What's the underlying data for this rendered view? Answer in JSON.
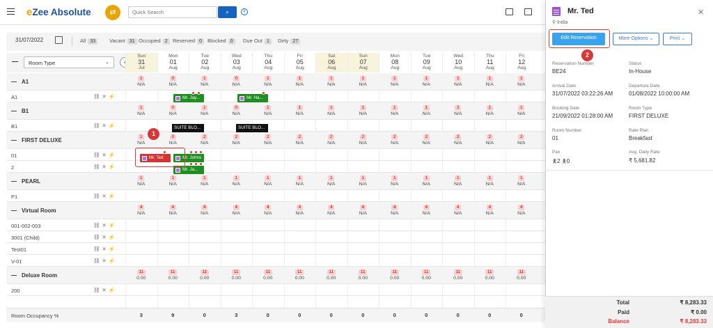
{
  "app": {
    "title_prefix": "e",
    "title_rest": "Zee Absolute"
  },
  "search": {
    "placeholder": "Quick Search"
  },
  "filters": {
    "date": "31/07/2022",
    "items": [
      {
        "label": "All",
        "count": "33"
      },
      {
        "label": "Vacant",
        "count": "31"
      },
      {
        "label": "Occupied",
        "count": "2"
      },
      {
        "label": "Reserved",
        "count": "0"
      },
      {
        "label": "Blocked",
        "count": "0"
      },
      {
        "label": "Due Out",
        "count": "1"
      },
      {
        "label": "Dirty",
        "count": "27"
      }
    ]
  },
  "grid": {
    "room_type_select": "Room Type",
    "days": [
      {
        "dow": "Sun",
        "day": "31",
        "month": "Jul",
        "weekend": true
      },
      {
        "dow": "Mon",
        "day": "01",
        "month": "Aug",
        "weekend": false
      },
      {
        "dow": "Tue",
        "day": "02",
        "month": "Aug",
        "weekend": false
      },
      {
        "dow": "Wed",
        "day": "03",
        "month": "Aug",
        "weekend": false
      },
      {
        "dow": "Thu",
        "day": "04",
        "month": "Aug",
        "weekend": false
      },
      {
        "dow": "Fri",
        "day": "05",
        "month": "Aug",
        "weekend": false
      },
      {
        "dow": "Sat",
        "day": "06",
        "month": "Aug",
        "weekend": true
      },
      {
        "dow": "Sun",
        "day": "07",
        "month": "Aug",
        "weekend": true
      },
      {
        "dow": "Mon",
        "day": "08",
        "month": "Aug",
        "weekend": false
      },
      {
        "dow": "Tue",
        "day": "09",
        "month": "Aug",
        "weekend": false
      },
      {
        "dow": "Wed",
        "day": "10",
        "month": "Aug",
        "weekend": false
      },
      {
        "dow": "Thu",
        "day": "11",
        "month": "Aug",
        "weekend": false
      },
      {
        "dow": "Fri",
        "day": "12",
        "month": "Aug",
        "weekend": false
      }
    ],
    "room_types": [
      {
        "name": "A1",
        "avail": [
          "1",
          "0",
          "1",
          "0",
          "1",
          "1",
          "1",
          "1",
          "1",
          "1",
          "1",
          "1",
          "1"
        ],
        "sub": [
          "N/A",
          "N/A",
          "N/A",
          "N/A",
          "N/A",
          "N/A",
          "N/A",
          "N/A",
          "N/A",
          "N/A",
          "N/A",
          "N/A",
          "N/A"
        ],
        "rooms": [
          "A1"
        ]
      },
      {
        "name": "B1",
        "avail": [
          "1",
          "0",
          "1",
          "0",
          "1",
          "1",
          "1",
          "1",
          "1",
          "1",
          "1",
          "1",
          "1"
        ],
        "sub": [
          "N/A",
          "N/A",
          "N/A",
          "N/A",
          "N/A",
          "N/A",
          "N/A",
          "N/A",
          "N/A",
          "N/A",
          "N/A",
          "N/A",
          "N/A"
        ],
        "rooms": [
          "B1"
        ]
      },
      {
        "name": "FIRST DELUXE",
        "avail": [
          "1",
          "0",
          "2",
          "2",
          "2",
          "2",
          "2",
          "2",
          "2",
          "2",
          "2",
          "2",
          "2"
        ],
        "sub": [
          "N/A",
          "N/A",
          "N/A",
          "N/A",
          "N/A",
          "N/A",
          "N/A",
          "N/A",
          "N/A",
          "N/A",
          "N/A",
          "N/A",
          "N/A"
        ],
        "rooms": [
          "01",
          "2"
        ]
      },
      {
        "name": "PEARL",
        "avail": [
          "1",
          "1",
          "1",
          "1",
          "1",
          "1",
          "1",
          "1",
          "1",
          "1",
          "1",
          "1",
          "1"
        ],
        "sub": [
          "N/A",
          "N/A",
          "N/A",
          "N/A",
          "N/A",
          "N/A",
          "N/A",
          "N/A",
          "N/A",
          "N/A",
          "N/A",
          "N/A",
          "N/A"
        ],
        "rooms": [
          "P1"
        ]
      },
      {
        "name": "Virtual Room",
        "avail": [
          "4",
          "4",
          "4",
          "4",
          "4",
          "4",
          "4",
          "4",
          "4",
          "4",
          "4",
          "4",
          "4"
        ],
        "sub": [
          "N/A",
          "N/A",
          "N/A",
          "N/A",
          "N/A",
          "N/A",
          "N/A",
          "N/A",
          "N/A",
          "N/A",
          "N/A",
          "N/A",
          "N/A"
        ],
        "rooms": [
          "001-002-003",
          "3001 (Child)",
          "Test01",
          "V-01"
        ]
      },
      {
        "name": "Deluxe Room",
        "avail": [
          "11",
          "11",
          "11",
          "11",
          "11",
          "11",
          "11",
          "11",
          "11",
          "11",
          "11",
          "11",
          "11"
        ],
        "sub": [
          "0.00",
          "0.00",
          "0.00",
          "0.00",
          "0.00",
          "0.00",
          "0.00",
          "0.00",
          "0.00",
          "0.00",
          "0.00",
          "0.00",
          "0.00"
        ],
        "rooms": [
          "200"
        ]
      }
    ],
    "reservations": {
      "a1_jay": "Mr. Jay...",
      "a1_ha": "Mr. Ha...",
      "b1_suite1": "SUITE BLO...",
      "b1_suite2": "SUITE BLO...",
      "fd_ted": "Mr. Ted",
      "fd_johns": "Mr. Johns",
      "fd_ja": "Mr. Ja..."
    },
    "occupancy_label": "Room Occupancy %",
    "occupancy": [
      "3",
      "9",
      "0",
      "3",
      "0",
      "0",
      "0",
      "0",
      "0",
      "0",
      "0",
      "0",
      "0"
    ],
    "step1": "1"
  },
  "panel": {
    "guest_name": "Mr. Ted",
    "location": "India",
    "edit_label": "Edit Reservation",
    "more_label": "More Options",
    "print_label": "Print",
    "step2": "2",
    "fields": {
      "res_no_label": "Reservation Number",
      "res_no": "BE24",
      "status_label": "Status",
      "status": "In-House",
      "arrival_label": "Arrival Date",
      "arrival": "31/07/2022 03:22:26 AM",
      "departure_label": "Departure Date",
      "departure": "01/08/2022 10:00:00 AM",
      "booking_label": "Booking Date",
      "booking": "21/09/2022 01:28:00 AM",
      "roomtype_label": "Room Type",
      "roomtype": "FIRST DELUXE",
      "roomno_label": "Room Number",
      "roomno": "01",
      "rateplan_label": "Rate Plan",
      "rateplan": "Breakfast",
      "pax_label": "Pax",
      "pax_adult": "2",
      "pax_child": "0",
      "adr_label": "Avg. Daily Rate",
      "adr": "₹ 5,681.82"
    },
    "totals": {
      "total_label": "Total",
      "total": "₹ 8,283.33",
      "paid_label": "Paid",
      "paid": "₹ 0.00",
      "balance_label": "Balance",
      "balance": "₹ 8,283.33"
    }
  }
}
